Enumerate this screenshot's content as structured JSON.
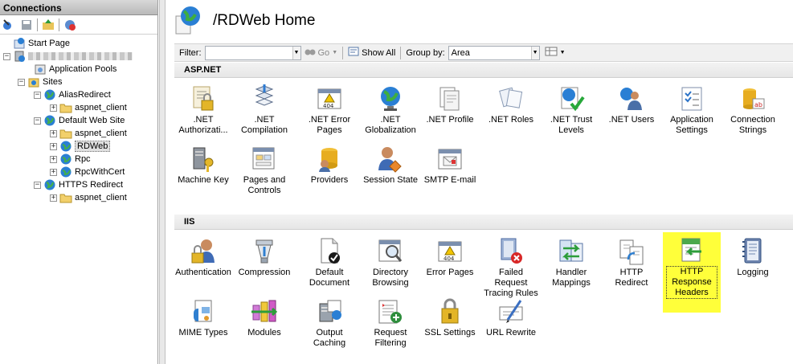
{
  "connections": {
    "title": "Connections",
    "tree": [
      {
        "label": "Start Page",
        "icon": "start-page-icon"
      },
      {
        "label": "",
        "icon": "server-icon",
        "blurred": true
      },
      {
        "label": "Application Pools",
        "icon": "app-pools-icon"
      },
      {
        "label": "Sites",
        "icon": "sites-icon"
      },
      {
        "label": "AliasRedirect",
        "icon": "globe-icon"
      },
      {
        "label": "aspnet_client",
        "icon": "folder-icon"
      },
      {
        "label": "Default Web Site",
        "icon": "globe-icon"
      },
      {
        "label": "aspnet_client",
        "icon": "folder-icon"
      },
      {
        "label": "RDWeb",
        "icon": "globe-app-icon",
        "selected": true
      },
      {
        "label": "Rpc",
        "icon": "globe-app-icon"
      },
      {
        "label": "RpcWithCert",
        "icon": "globe-app-icon"
      },
      {
        "label": "HTTPS Redirect",
        "icon": "globe-icon"
      },
      {
        "label": "aspnet_client",
        "icon": "folder-icon"
      }
    ]
  },
  "page": {
    "title": "/RDWeb Home"
  },
  "filterbar": {
    "filter_label": "Filter:",
    "filter_value": "",
    "go_label": "Go",
    "show_all_label": "Show All",
    "group_by_label": "Group by:",
    "group_by_value": "Area"
  },
  "sections": {
    "aspnet": {
      "title": "ASP.NET",
      "items": [
        {
          "label": ".NET Authorizati...",
          "icon": "lock-user-icon"
        },
        {
          "label": ".NET Compilation",
          "icon": "compile-icon"
        },
        {
          "label": ".NET Error Pages",
          "icon": "error-404-icon"
        },
        {
          "label": ".NET Globalization",
          "icon": "globe-icon"
        },
        {
          "label": ".NET Profile",
          "icon": "profile-icon"
        },
        {
          "label": ".NET Roles",
          "icon": "roles-icon"
        },
        {
          "label": ".NET Trust Levels",
          "icon": "trust-icon"
        },
        {
          "label": ".NET Users",
          "icon": "users-icon"
        },
        {
          "label": "Application Settings",
          "icon": "app-settings-icon"
        },
        {
          "label": "Connection Strings",
          "icon": "db-icon"
        },
        {
          "label": "Machine Key",
          "icon": "machine-key-icon"
        },
        {
          "label": "Pages and Controls",
          "icon": "pages-controls-icon"
        },
        {
          "label": "Providers",
          "icon": "providers-icon"
        },
        {
          "label": "Session State",
          "icon": "session-icon"
        },
        {
          "label": "SMTP E-mail",
          "icon": "smtp-icon"
        }
      ]
    },
    "iis": {
      "title": "IIS",
      "items": [
        {
          "label": "Authentication",
          "icon": "auth-icon"
        },
        {
          "label": "Compression",
          "icon": "compression-icon"
        },
        {
          "label": "Default Document",
          "icon": "default-doc-icon"
        },
        {
          "label": "Directory Browsing",
          "icon": "dir-browse-icon"
        },
        {
          "label": "Error Pages",
          "icon": "error-404-icon"
        },
        {
          "label": "Failed Request Tracing Rules",
          "icon": "failed-req-icon"
        },
        {
          "label": "Handler Mappings",
          "icon": "handler-icon"
        },
        {
          "label": "HTTP Redirect",
          "icon": "redirect-icon"
        },
        {
          "label": "HTTP Response Headers",
          "icon": "headers-icon",
          "selected": true
        },
        {
          "label": "Logging",
          "icon": "logging-icon"
        },
        {
          "label": "MIME Types",
          "icon": "mime-icon"
        },
        {
          "label": "Modules",
          "icon": "modules-icon"
        },
        {
          "label": "Output Caching",
          "icon": "output-cache-icon"
        },
        {
          "label": "Request Filtering",
          "icon": "request-filter-icon"
        },
        {
          "label": "SSL Settings",
          "icon": "ssl-icon"
        },
        {
          "label": "URL Rewrite",
          "icon": "url-rewrite-icon"
        }
      ]
    }
  },
  "colors": {
    "selection": "#ffff3a",
    "globe": "#2a7fd4",
    "folder": "#f2d06b"
  }
}
